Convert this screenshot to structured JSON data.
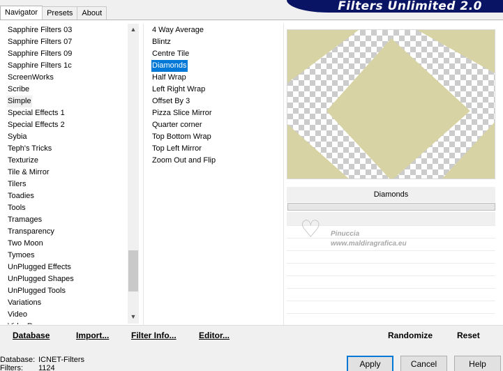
{
  "brand_title": "Filters Unlimited 2.0",
  "tabs": [
    "Navigator",
    "Presets",
    "About"
  ],
  "categories": [
    "Sapphire Filters 03",
    "Sapphire Filters 07",
    "Sapphire Filters 09",
    "Sapphire Filters 1c",
    "ScreenWorks",
    "Scribe",
    "Simple",
    "Special Effects 1",
    "Special Effects 2",
    "Sybia",
    "Teph's Tricks",
    "Texturize",
    "Tile & Mirror",
    "Tilers",
    "Toadies",
    "Tools",
    "Tramages",
    "Transparency",
    "Two Moon",
    "Tymoes",
    "UnPlugged Effects",
    "UnPlugged Shapes",
    "UnPlugged Tools",
    "Variations",
    "Video",
    "VideoRave"
  ],
  "selected_category": "Simple",
  "filters": [
    "4 Way Average",
    "Blintz",
    "Centre Tile",
    "Diamonds",
    "Half Wrap",
    "Left Right Wrap",
    "Offset By 3",
    "Pizza Slice Mirror",
    "Quarter corner",
    "Top Bottom Wrap",
    "Top Left Mirror",
    "Zoom Out and Flip"
  ],
  "selected_filter": "Diamonds",
  "preview": {
    "shape_color": "#d8d3a4",
    "checker_color": "#cccccc"
  },
  "current_filter_label": "Diamonds",
  "watermark": {
    "name": "Pinuccia",
    "url": "www.maldiragrafica.eu"
  },
  "buttons": {
    "database": "Database",
    "import": "Import...",
    "filter_info": "Filter Info...",
    "editor": "Editor...",
    "randomize": "Randomize",
    "reset": "Reset"
  },
  "status": {
    "database_label": "Database:",
    "database_value": "ICNET-Filters",
    "filters_label": "Filters:",
    "filters_value": "1124"
  },
  "dialog_buttons": {
    "apply": "Apply",
    "cancel": "Cancel",
    "help": "Help"
  },
  "accent_color": "#0078d7"
}
